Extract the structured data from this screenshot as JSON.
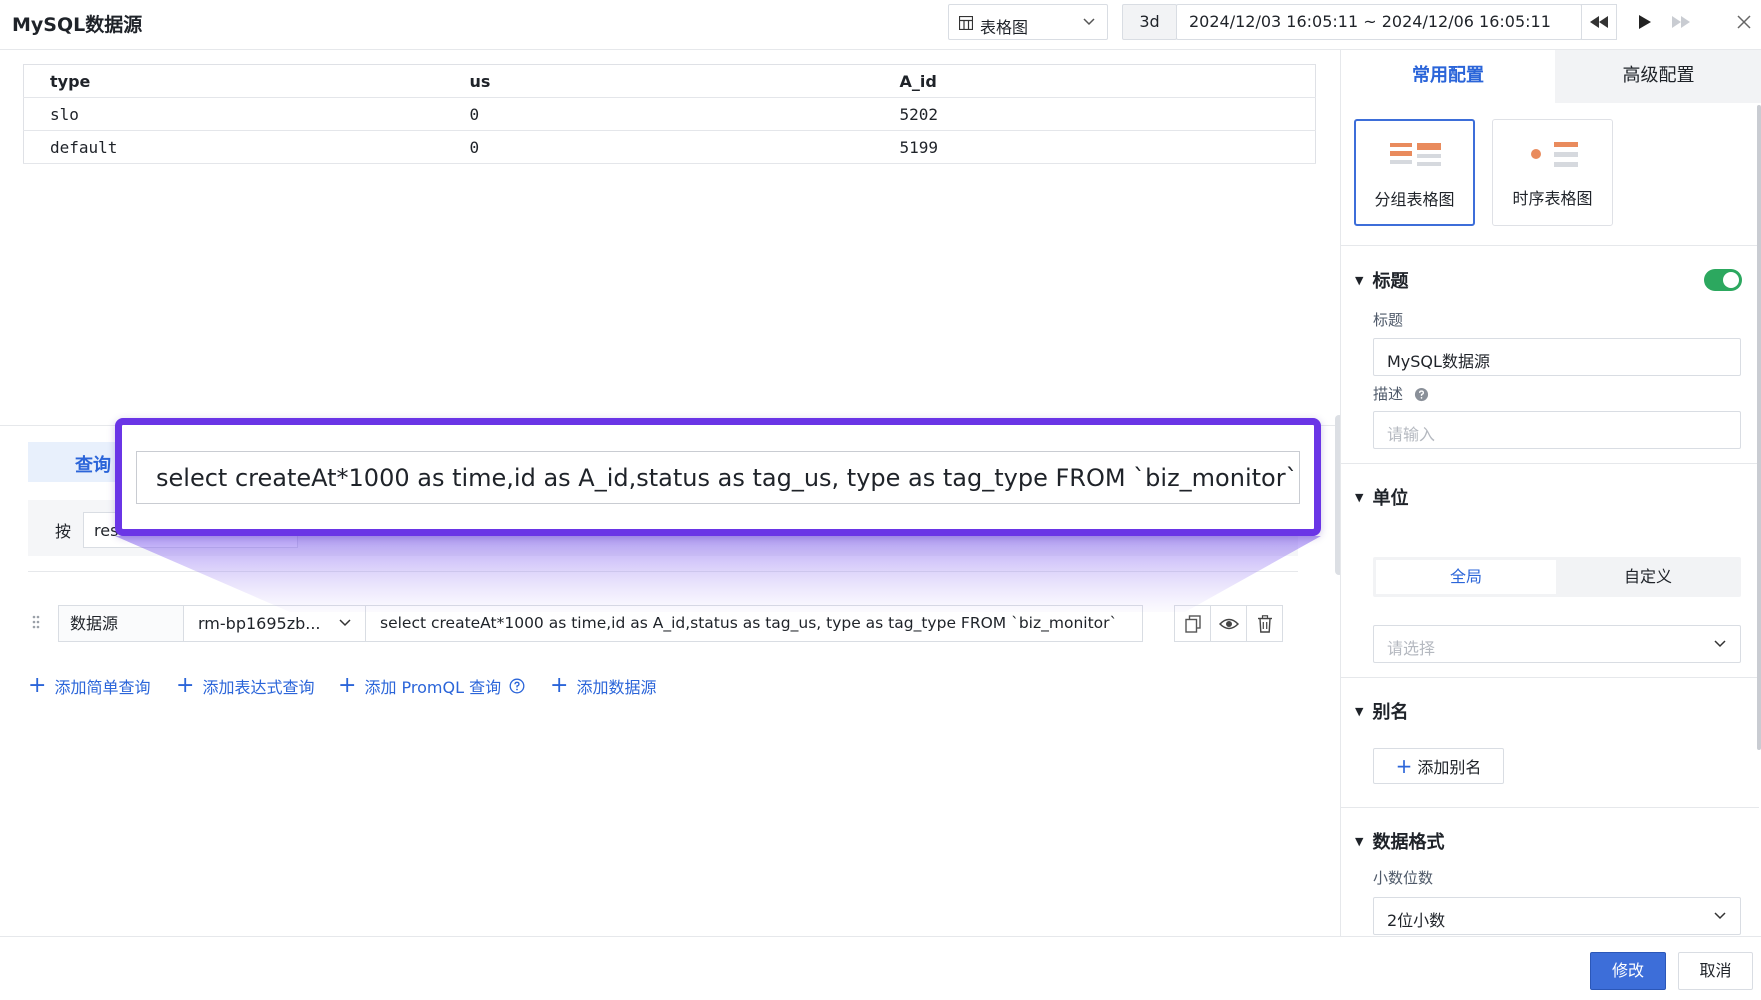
{
  "header": {
    "title": "MySQL数据源",
    "viz_type": "表格图",
    "range_quick": "3d",
    "range_text": "2024/12/03 16:05:11 ~ 2024/12/06 16:05:11"
  },
  "results": {
    "columns": [
      "type",
      "us",
      "A_id"
    ],
    "rows": [
      [
        "slo",
        "0",
        "5202"
      ],
      [
        "default",
        "0",
        "5199"
      ]
    ]
  },
  "query": {
    "tab_label": "查询",
    "sub_label": "按",
    "sub_input_value": "res",
    "datasource_label": "数据源",
    "datasource_value": "rm-bp1695zb...",
    "sql": "select createAt*1000 as time,id as A_id,status as tag_us, type as tag_type FROM `biz_monitor`",
    "add_links": [
      "添加简单查询",
      "添加表达式查询",
      "添加 PromQL 查询",
      "添加数据源"
    ]
  },
  "callout": {
    "text": "select createAt*1000 as time,id as A_id,status as tag_us, type as tag_type FROM `biz_monitor`"
  },
  "footer": {
    "save_label": "修改",
    "cancel_label": "取消"
  },
  "panel": {
    "tabs": [
      "常用配置",
      "高级配置"
    ],
    "viz_cards": [
      "分组表格图",
      "时序表格图"
    ],
    "title_section": {
      "heading": "标题",
      "toggle_on": true,
      "title_label": "标题",
      "title_value": "MySQL数据源",
      "desc_label": "描述",
      "desc_placeholder": "请输入"
    },
    "unit_section": {
      "heading": "单位",
      "options": [
        "全局",
        "自定义"
      ],
      "selected": "全局",
      "select_placeholder": "请选择"
    },
    "alias_section": {
      "heading": "别名",
      "add_label": "添加别名"
    },
    "format_section": {
      "heading": "数据格式",
      "decimals_label": "小数位数",
      "decimals_value": "2位小数"
    }
  },
  "colors": {
    "accent": "#2b65d9",
    "callout_border": "#6a35e6",
    "toggle_on": "#2ca85f",
    "primary_button": "#3d6ed9"
  }
}
